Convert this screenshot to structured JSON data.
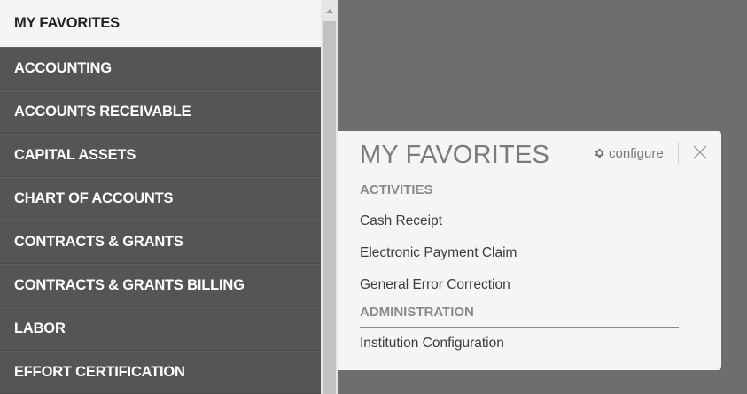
{
  "sidebar": {
    "items": [
      {
        "label": "MY FAVORITES"
      },
      {
        "label": "ACCOUNTING"
      },
      {
        "label": "ACCOUNTS RECEIVABLE"
      },
      {
        "label": "CAPITAL ASSETS"
      },
      {
        "label": "CHART OF ACCOUNTS"
      },
      {
        "label": "CONTRACTS & GRANTS"
      },
      {
        "label": "CONTRACTS & GRANTS BILLING"
      },
      {
        "label": "LABOR"
      },
      {
        "label": "EFFORT CERTIFICATION"
      }
    ]
  },
  "panel": {
    "title": "MY FAVORITES",
    "configure_label": "configure",
    "sections": [
      {
        "header": "ACTIVITIES",
        "links": [
          "Cash Receipt",
          "Electronic Payment Claim",
          "General Error Correction"
        ]
      },
      {
        "header": "ADMINISTRATION",
        "links": [
          "Institution Configuration"
        ]
      }
    ]
  },
  "icons": {
    "configure": "gear-icon",
    "close": "close-icon",
    "scroll_up": "chevron-up-icon"
  },
  "colors": {
    "sidebar_bg": "#555555",
    "active_bg": "#f5f5f5",
    "backdrop": "#6e6e6e",
    "panel_bg": "#f5f5f5"
  }
}
